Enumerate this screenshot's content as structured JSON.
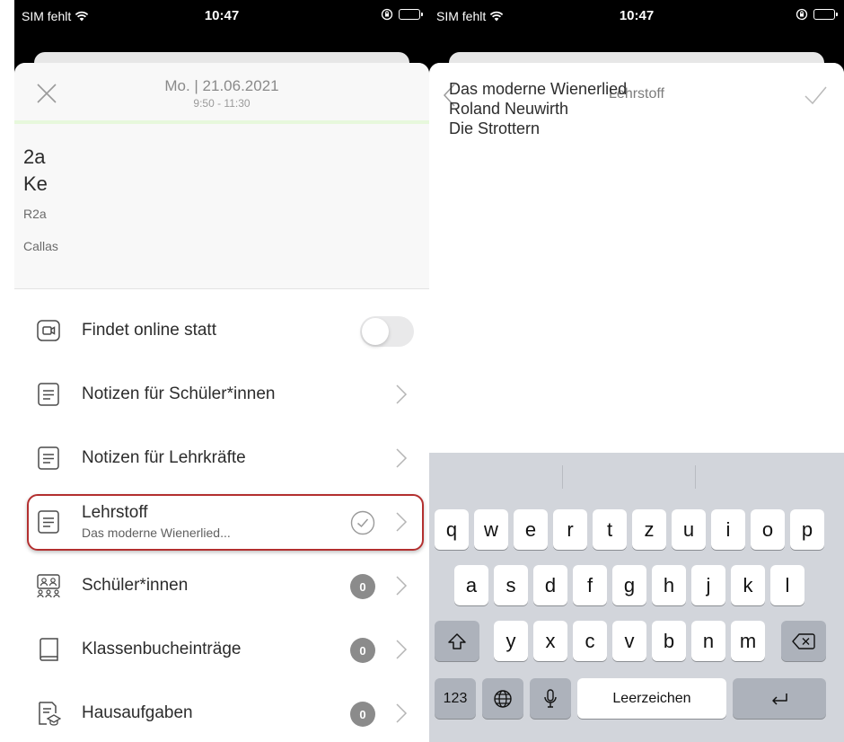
{
  "status_bar": {
    "carrier": "SIM fehlt",
    "time": "10:47"
  },
  "lesson_screen": {
    "date": "Mo. | 21.06.2021",
    "time_range": "9:50 - 11:30",
    "class_name": "2a",
    "teacher": "Ke",
    "room": "R2a",
    "location": "Callas",
    "online_toggle_on": false,
    "items": [
      {
        "label": "Findet online statt",
        "icon": "video-icon"
      },
      {
        "label": "Notizen für Schüler*innen",
        "icon": "note-icon"
      },
      {
        "label": "Notizen für Lehrkräfte",
        "icon": "note-icon"
      },
      {
        "label": "Lehrstoff",
        "subtitle": "Das moderne Wienerlied...",
        "icon": "note-icon"
      },
      {
        "label": "Schüler*innen",
        "count": "0",
        "icon": "students-icon"
      },
      {
        "label": "Klassenbucheinträge",
        "count": "0",
        "icon": "book-icon"
      },
      {
        "label": "Hausaufgaben",
        "count": "0",
        "icon": "homework-icon"
      }
    ]
  },
  "lehrstoff_screen": {
    "title": "Lehrstoff",
    "content": "Das moderne Wienerlied\nRoland Neuwirth\nDie Strottern"
  },
  "keyboard": {
    "row1": [
      "q",
      "w",
      "e",
      "r",
      "t",
      "z",
      "u",
      "i",
      "o",
      "p"
    ],
    "row2": [
      "a",
      "s",
      "d",
      "f",
      "g",
      "h",
      "j",
      "k",
      "l"
    ],
    "row3": [
      "y",
      "x",
      "c",
      "v",
      "b",
      "n",
      "m"
    ],
    "numbers_key": "123",
    "space_key": "Leerzeichen"
  },
  "colors": {
    "highlight_border": "#b32f2f",
    "header_accent": "#e7f8dc",
    "badge": "#8b8b8b"
  }
}
